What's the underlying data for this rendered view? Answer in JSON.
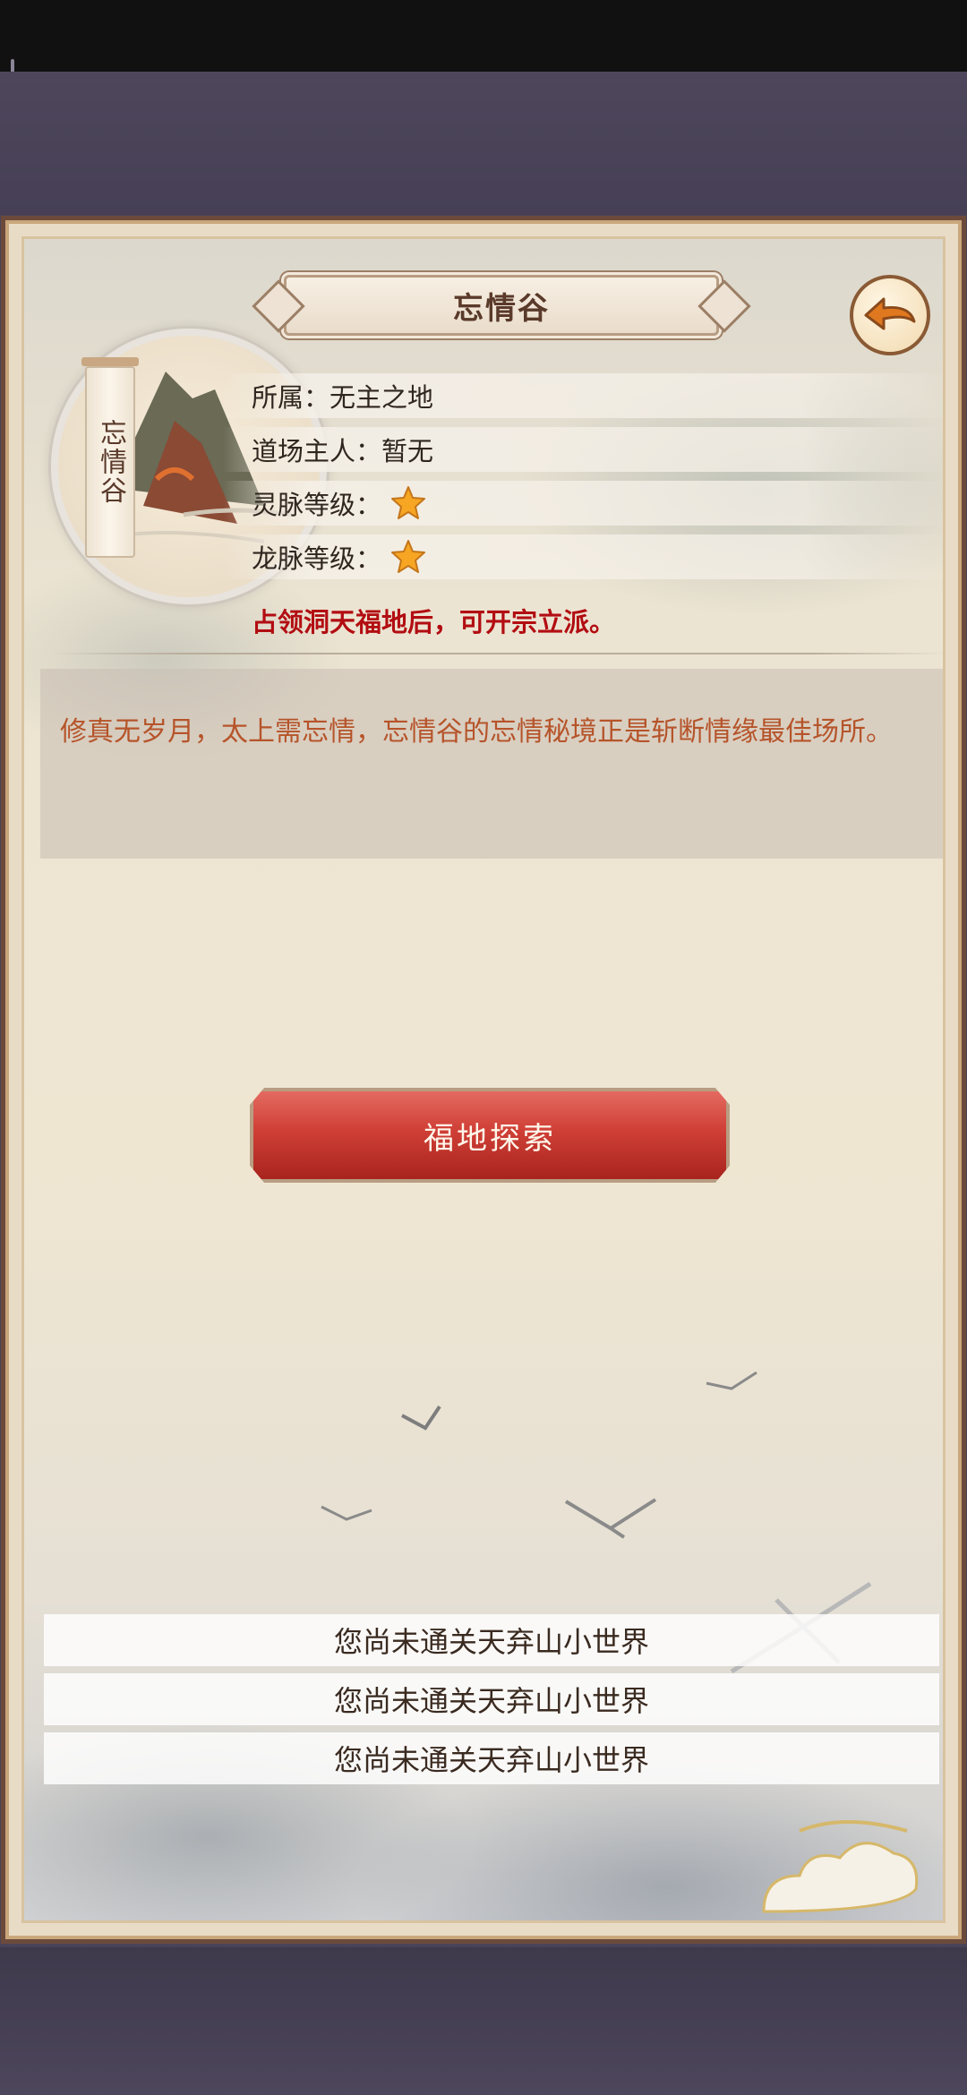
{
  "header": {
    "title": "忘情谷"
  },
  "portrait": {
    "tag": "忘情谷"
  },
  "info": {
    "rows": [
      {
        "label": "所属：",
        "value": "无主之地"
      },
      {
        "label": "道场主人：",
        "value": "暂无"
      },
      {
        "label": "灵脉等级：",
        "stars": 1
      },
      {
        "label": "龙脉等级：",
        "stars": 1
      }
    ],
    "notice": "占领洞天福地后，可开宗立派。"
  },
  "description": "修真无岁月，太上需忘情，忘情谷的忘情秘境正是斩断情缘最佳场所。",
  "actions": {
    "explore_label": "福地探索"
  },
  "locked": [
    "您尚未通关天弃山小世界",
    "您尚未通关天弃山小世界",
    "您尚未通关天弃山小世界"
  ],
  "icons": {
    "back": "back-arrow-icon",
    "star": "star-icon"
  },
  "colors": {
    "notice": "#b20d12",
    "description": "#b6542a",
    "explore_button": "#cf3f36",
    "frame_border": "#6c4a3b"
  }
}
